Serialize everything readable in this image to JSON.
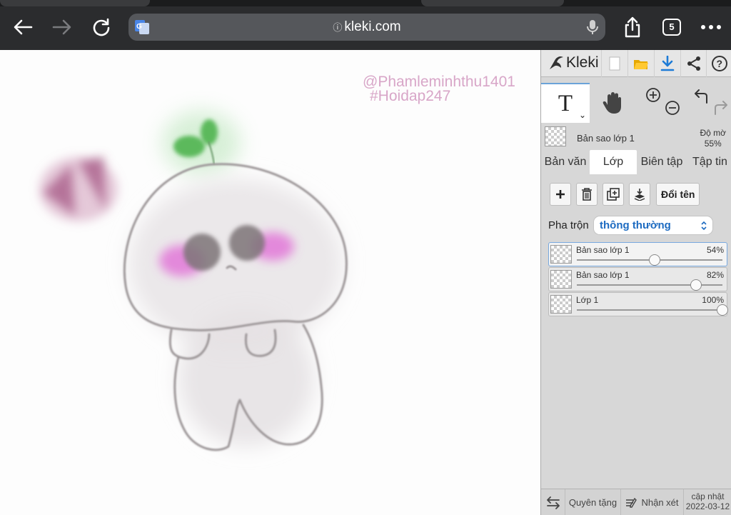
{
  "browser": {
    "url": "kleki.com",
    "tab_count": "5",
    "icons": [
      "back-icon",
      "forward-icon",
      "reload-icon",
      "translate-icon",
      "lock-icon",
      "microphone-icon",
      "share-icon",
      "tabs-icon",
      "more-icon"
    ]
  },
  "canvas": {
    "watermark_line1": "@Phamleminhthu1401",
    "watermark_line2": "#Hoidap247"
  },
  "app": {
    "name": "Kleki",
    "top_icons": [
      "new-file-icon",
      "open-folder-icon",
      "download-icon",
      "share-icon",
      "help-icon"
    ],
    "tools": [
      "text-tool",
      "hand-tool",
      "zoom-in",
      "zoom-out",
      "undo",
      "redo"
    ],
    "text_tool_label": "T",
    "current_layer": {
      "name": "Bản sao lớp 1",
      "opacity_label": "Độ mờ",
      "opacity_value": "55%"
    },
    "tabs": [
      {
        "label": "Bản văn",
        "active": false
      },
      {
        "label": "Lớp",
        "active": true
      },
      {
        "label": "Biên tập",
        "active": false
      },
      {
        "label": "Tập tin",
        "active": false
      }
    ],
    "rename_label": "Đổi tên",
    "blend": {
      "label": "Pha trộn",
      "value": "thông thường"
    },
    "layers": [
      {
        "name": "Bản sao lớp 1",
        "pct_label": "54%",
        "opacity": 0.54,
        "selected": true
      },
      {
        "name": "Bản sao lớp 1",
        "pct_label": "82%",
        "opacity": 0.82,
        "selected": false
      },
      {
        "name": "Lớp 1",
        "pct_label": "100%",
        "opacity": 1.0,
        "selected": false
      }
    ],
    "footer": {
      "donate": "Quyên tặng",
      "feedback": "Nhận xét",
      "update_label": "cập nhật",
      "update_date": "2022-03-12"
    }
  },
  "colors": {
    "accent_blue": "#1d6bc1",
    "chrome_dark": "#2b2c2e"
  }
}
